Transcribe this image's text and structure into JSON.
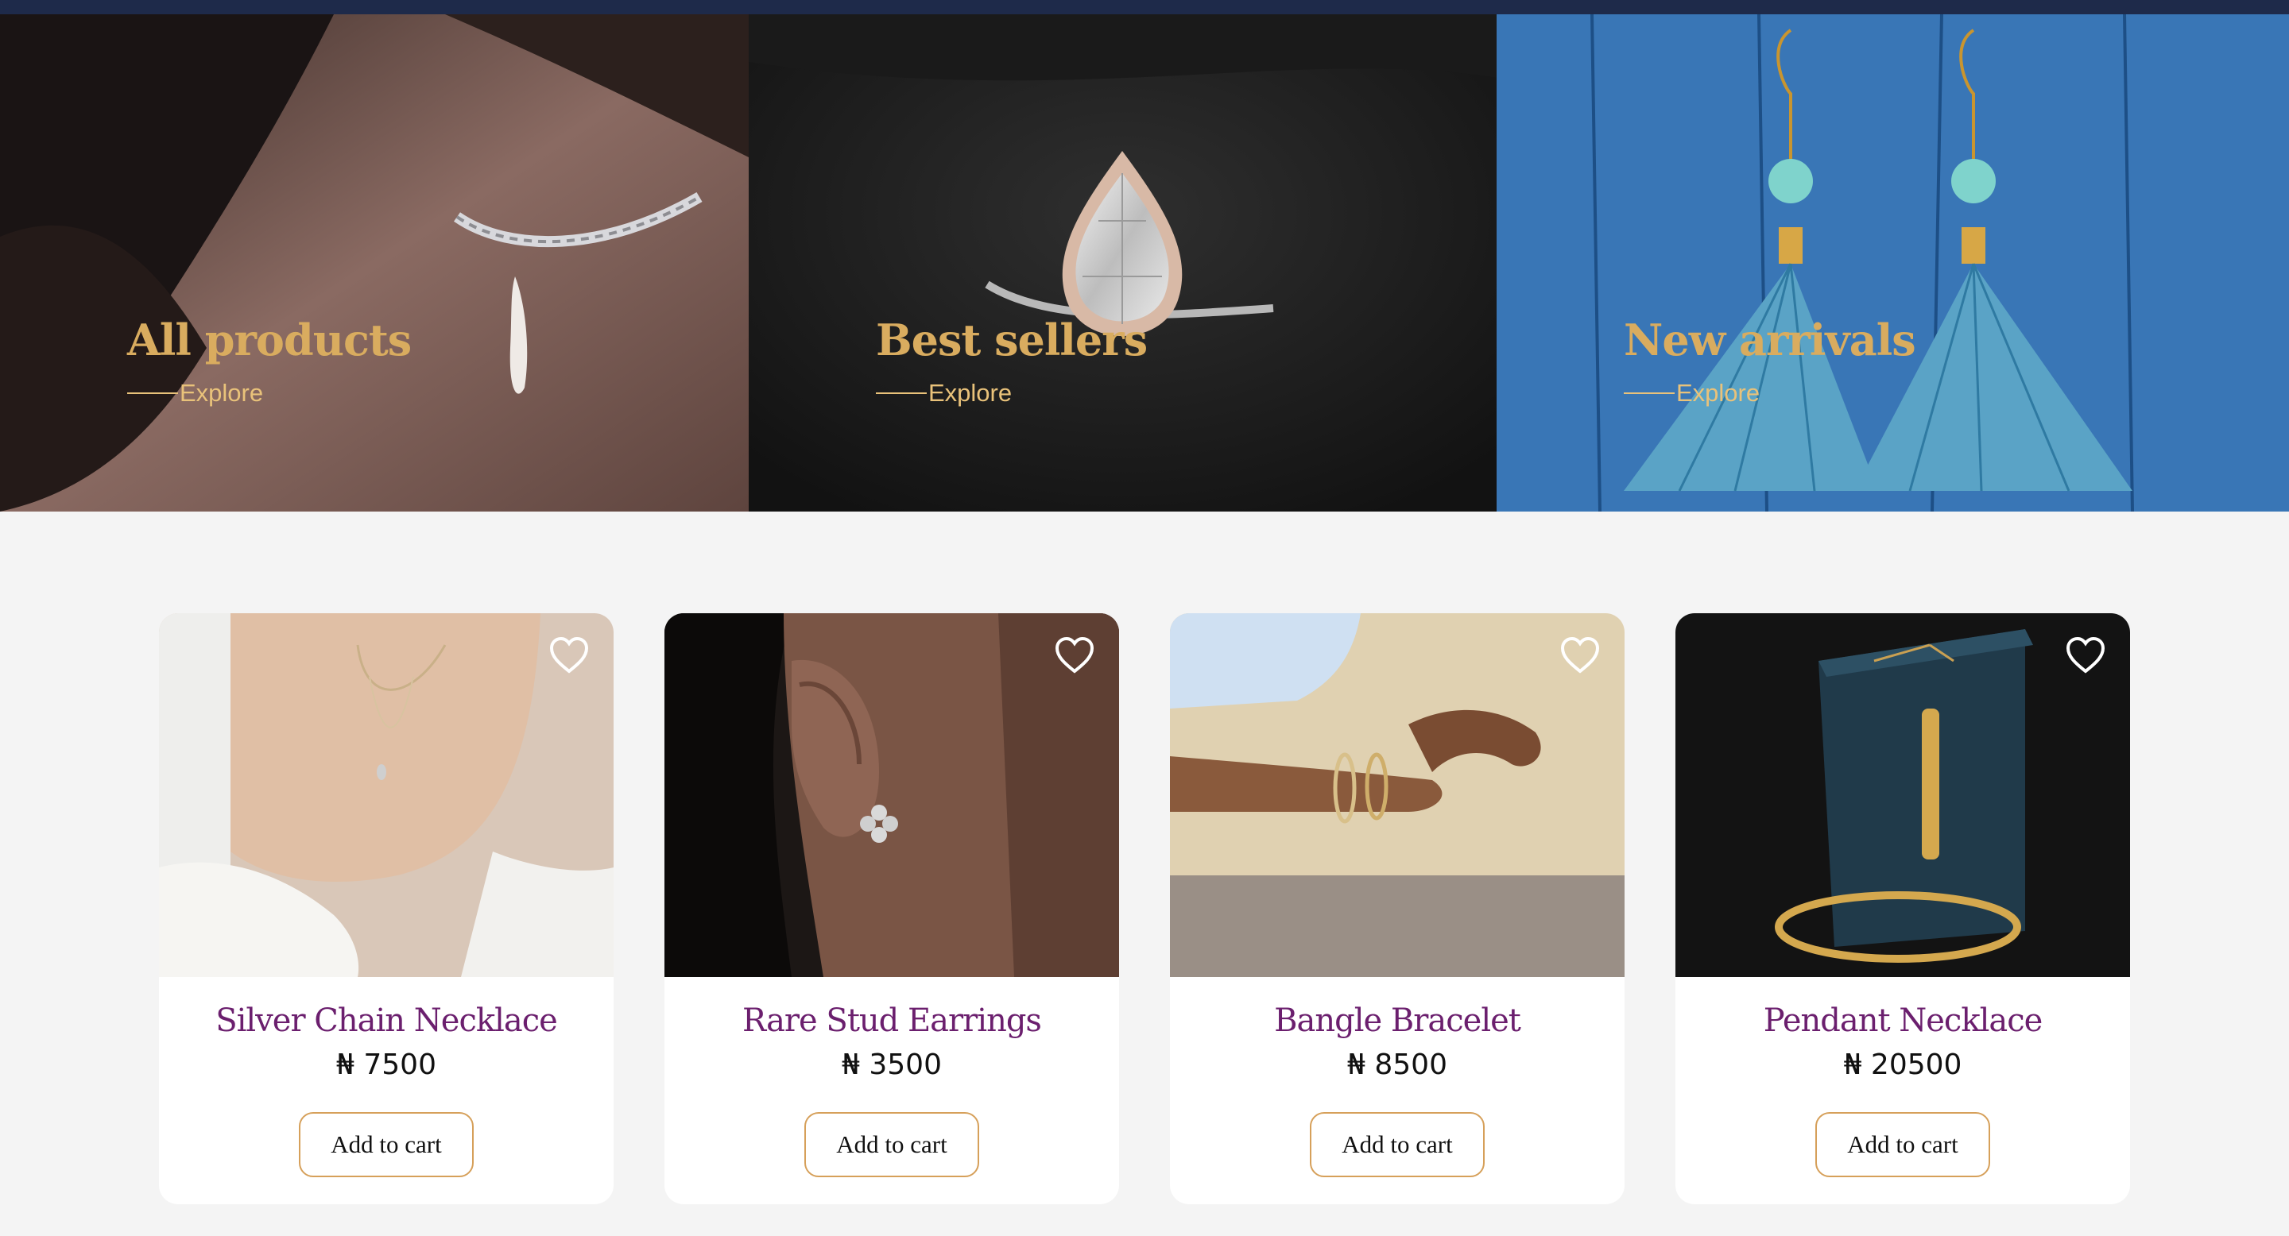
{
  "currency_symbol": "₦",
  "banners": [
    {
      "title": "All products",
      "link": "Explore"
    },
    {
      "title": "Best sellers",
      "link": "Explore"
    },
    {
      "title": "New arrivals",
      "link": "Explore"
    }
  ],
  "products": [
    {
      "name": "Silver Chain Necklace",
      "price": "₦ 7500",
      "button": "Add to cart",
      "favorite_icon": "heart-outline-icon"
    },
    {
      "name": "Rare Stud Earrings",
      "price": "₦ 3500",
      "button": "Add to cart",
      "favorite_icon": "heart-outline-icon"
    },
    {
      "name": "Bangle Bracelet",
      "price": "₦ 8500",
      "button": "Add to cart",
      "favorite_icon": "heart-outline-icon"
    },
    {
      "name": "Pendant Necklace",
      "price": "₦ 20500",
      "button": "Add to cart",
      "favorite_icon": "heart-outline-icon"
    }
  ],
  "colors": {
    "accent_gold": "#d9ac5f",
    "product_name": "#6b1f6e",
    "button_border": "#d6a05a",
    "page_background": "#f4f4f4"
  }
}
